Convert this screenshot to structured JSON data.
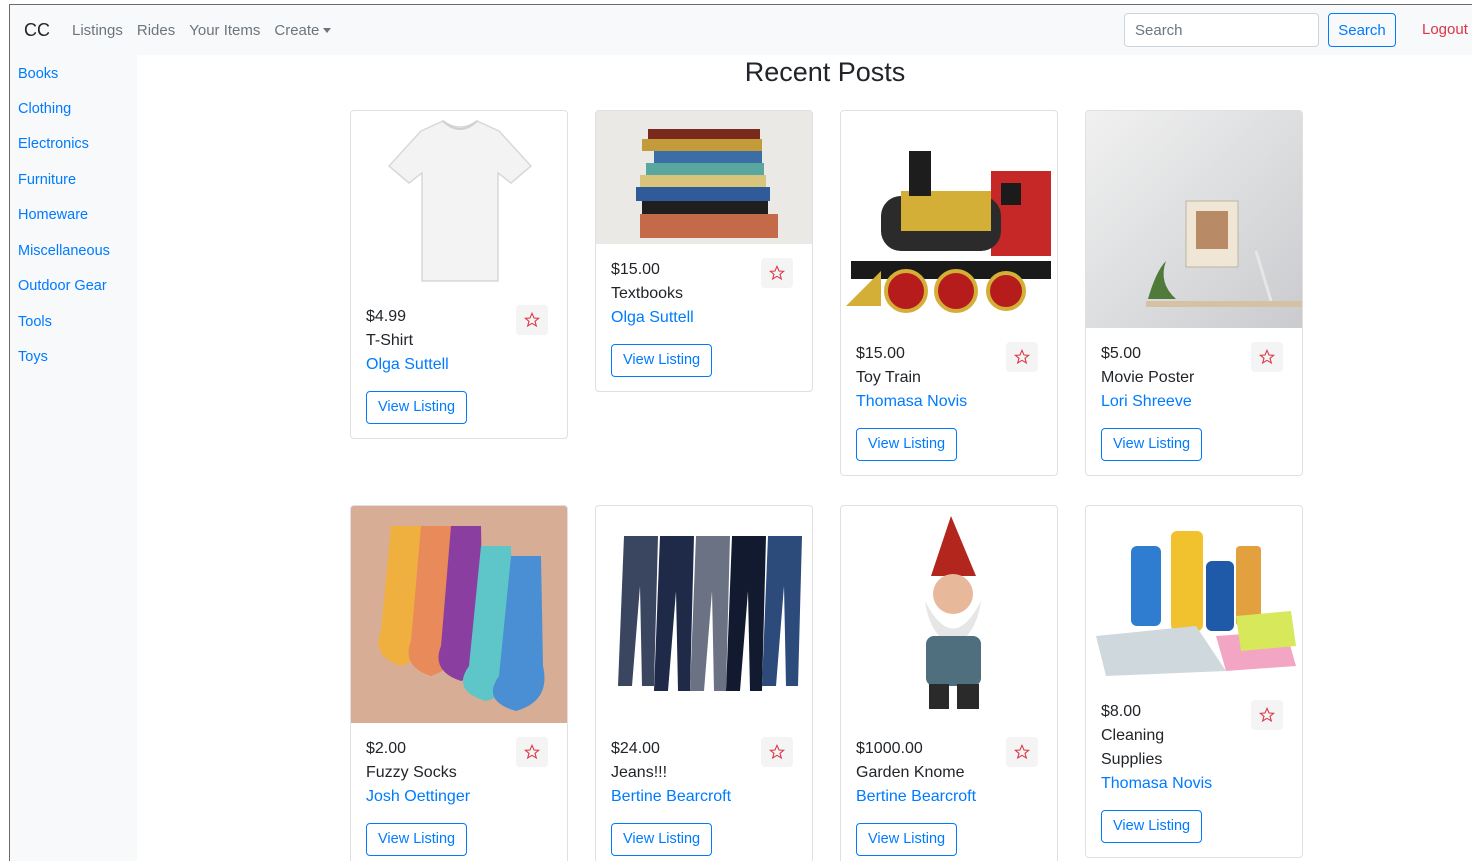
{
  "navbar": {
    "brand": "CC",
    "links": [
      "Listings",
      "Rides",
      "Your Items",
      "Create"
    ],
    "search_placeholder": "Search",
    "search_button": "Search",
    "logout": "Logout"
  },
  "sidebar": {
    "items": [
      "Books",
      "Clothing",
      "Electronics",
      "Furniture",
      "Homeware",
      "Miscellaneous",
      "Outdoor Gear",
      "Tools",
      "Toys"
    ]
  },
  "main": {
    "title": "Recent Posts",
    "cards": [
      {
        "price": "$4.99",
        "title": "T-Shirt",
        "seller": "Olga Suttell",
        "button": "View Listing",
        "icon": "star-outline-icon"
      },
      {
        "price": "$15.00",
        "title": "Textbooks",
        "seller": "Olga Suttell",
        "button": "View Listing",
        "icon": "star-outline-icon"
      },
      {
        "price": "$15.00",
        "title": "Toy Train",
        "seller": "Thomasa Novis",
        "button": "View Listing",
        "icon": "star-outline-icon"
      },
      {
        "price": "$5.00",
        "title": "Movie Poster",
        "seller": "Lori Shreeve",
        "button": "View Listing",
        "icon": "star-outline-icon"
      },
      {
        "price": "$2.00",
        "title": "Fuzzy Socks",
        "seller": "Josh Oettinger",
        "button": "View Listing",
        "icon": "star-outline-icon"
      },
      {
        "price": "$24.00",
        "title": "Jeans!!!",
        "seller": "Bertine Bearcroft",
        "button": "View Listing",
        "icon": "star-outline-icon"
      },
      {
        "price": "$1000.00",
        "title": "Garden Knome",
        "seller": "Bertine Bearcroft",
        "button": "View Listing",
        "icon": "star-outline-icon"
      },
      {
        "price": "$8.00",
        "title": "Cleaning Supplies",
        "seller": "Thomasa Novis",
        "button": "View Listing",
        "icon": "star-outline-icon"
      }
    ]
  },
  "colors": {
    "link": "#007bff",
    "logout": "#dc3545",
    "navbar_bg": "#f8f9fa",
    "star": "#dc3545"
  }
}
